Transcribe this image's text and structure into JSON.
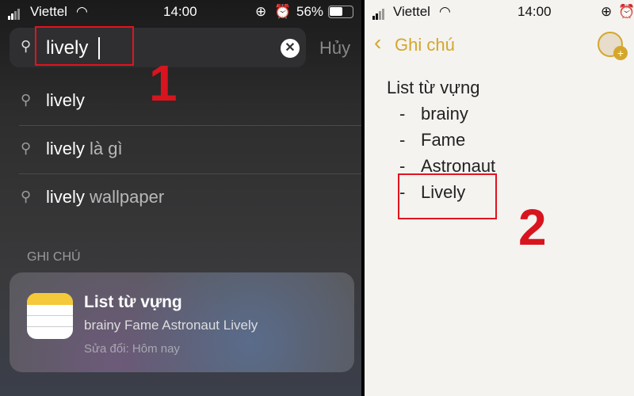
{
  "left": {
    "status": {
      "carrier": "Viettel",
      "time": "14:00",
      "battery": "56%"
    },
    "search": {
      "value": "lively",
      "cancel": "Hủy"
    },
    "annotation": "1",
    "suggestions": [
      {
        "bold": "lively",
        "rest": ""
      },
      {
        "bold": "lively",
        "rest": " là gì"
      },
      {
        "bold": "lively",
        "rest": " wallpaper"
      }
    ],
    "section": "GHI CHÚ",
    "result": {
      "title": "List từ vựng",
      "snippet": "brainy Fame Astronaut Lively",
      "modified": "Sửa đổi: Hôm nay"
    }
  },
  "right": {
    "status": {
      "carrier": "Viettel",
      "time": "14:00"
    },
    "nav": {
      "back": "Ghi chú"
    },
    "note": {
      "title": "List từ vựng",
      "items": [
        "brainy",
        "Fame",
        "Astronaut",
        "Lively"
      ],
      "dash": "-"
    },
    "annotation": "2"
  },
  "colors": {
    "accent": "#d4a72c",
    "highlight": "#e0141e"
  }
}
